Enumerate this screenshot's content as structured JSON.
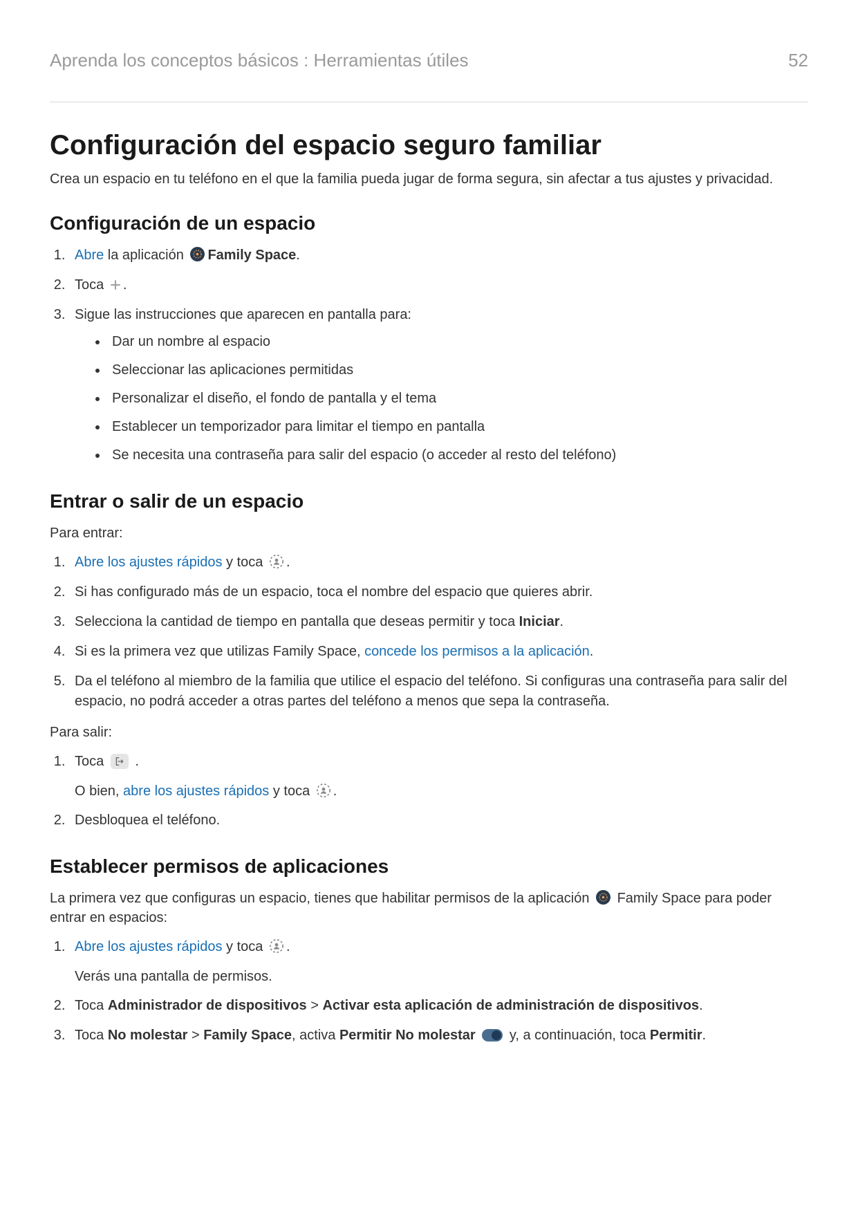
{
  "header": {
    "breadcrumb": "Aprenda los conceptos básicos : Herramientas útiles",
    "page_number": "52"
  },
  "title": "Configuración del espacio seguro familiar",
  "intro": "Crea un espacio en tu teléfono en el que la familia pueda jugar de forma segura, sin afectar a tus ajustes y privacidad.",
  "section1": {
    "heading": "Configuración de un espacio",
    "step1": {
      "link": "Abre",
      "text_a": " la aplicación ",
      "bold": "Family Space",
      "text_b": "."
    },
    "step2": {
      "text_a": "Toca ",
      "text_b": "."
    },
    "step3": {
      "lead": "Sigue las instrucciones que aparecen en pantalla para:",
      "bullets": [
        "Dar un nombre al espacio",
        "Seleccionar las aplicaciones permitidas",
        "Personalizar el diseño, el fondo de pantalla y el tema",
        "Establecer un temporizador para limitar el tiempo en pantalla",
        "Se necesita una contraseña para salir del espacio (o acceder al resto del teléfono)"
      ]
    }
  },
  "section2": {
    "heading": "Entrar o salir de un espacio",
    "enter_label": "Para entrar:",
    "enter_steps": {
      "s1": {
        "link": "Abre los ajustes rápidos",
        "mid": " y toca ",
        "end": "."
      },
      "s2": "Si has configurado más de un espacio, toca el nombre del espacio que quieres abrir.",
      "s3": {
        "a": "Selecciona la cantidad de tiempo en pantalla que deseas permitir y toca ",
        "bold": "Iniciar",
        "b": "."
      },
      "s4": {
        "a": "Si es la primera vez que utilizas Family Space, ",
        "link": "concede los permisos a la aplicación",
        "b": "."
      },
      "s5": "Da el teléfono al miembro de la familia que utilice el espacio del teléfono. Si configuras una contraseña para salir del espacio, no podrá acceder a otras partes del teléfono a menos que sepa la contraseña."
    },
    "exit_label": "Para salir:",
    "exit_steps": {
      "s1": {
        "a": "Toca ",
        "b": " ."
      },
      "s1_sub": {
        "a": "O bien, ",
        "link": "abre los ajustes rápidos",
        "mid": " y toca ",
        "end": "."
      },
      "s2": "Desbloquea el teléfono."
    }
  },
  "section3": {
    "heading": "Establecer permisos de aplicaciones",
    "intro": {
      "a": "La primera vez que configuras un espacio, tienes que habilitar permisos de la aplicación ",
      "b": " Family Space para poder entrar en espacios:"
    },
    "s1": {
      "link": "Abre los ajustes rápidos",
      "mid": " y toca ",
      "end": "."
    },
    "s1_sub": "Verás una pantalla de permisos.",
    "s2": {
      "a": "Toca ",
      "b1": "Administrador de dispositivos",
      "gt": " > ",
      "b2": "Activar esta aplicación de administración de dispositivos",
      "c": "."
    },
    "s3": {
      "a": "Toca ",
      "b1": "No molestar",
      "gt1": " > ",
      "b2": "Family Space",
      "mid": ", activa ",
      "b3": "Permitir No molestar",
      "after_toggle": " y, a continuación, toca ",
      "b4": "Permitir",
      "end": "."
    }
  }
}
